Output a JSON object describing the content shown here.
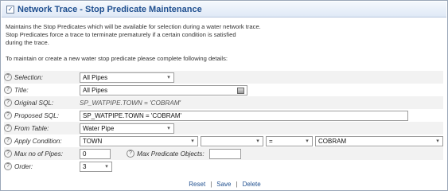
{
  "window": {
    "title": "Network Trace - Stop Predicate Maintenance"
  },
  "description": {
    "line1": "Maintains the Stop Predicates which will be available for selection during a water network trace.",
    "line2": "Stop Predicates force a trace to terminate prematurely if a certain condition is satisfied",
    "line3": "during the trace.",
    "line4": "To maintain or create a new water stop predicate please complete following details:"
  },
  "form": {
    "selection": {
      "label": "Selection:",
      "value": "All Pipes"
    },
    "title": {
      "label": "Title:",
      "value": "All Pipes"
    },
    "original_sql": {
      "label": "Original SQL:",
      "value": "SP_WATPIPE.TOWN = 'COBRAM'"
    },
    "proposed_sql": {
      "label": "Proposed SQL:",
      "value": "SP_WATPIPE.TOWN = 'COBRAM'"
    },
    "from_table": {
      "label": "From Table:",
      "value": "Water Pipe"
    },
    "apply_condition": {
      "label": "Apply Condition:",
      "field": "TOWN",
      "second": "",
      "operator": "=",
      "value": "COBRAM"
    },
    "max_pipes": {
      "label": "Max no of Pipes:",
      "value": "0"
    },
    "max_objects": {
      "label": "Max Predicate Objects:",
      "value": ""
    },
    "order": {
      "label": "Order:",
      "value": "3"
    }
  },
  "footer": {
    "reset": "Reset",
    "save": "Save",
    "delete": "Delete",
    "separator": "|"
  },
  "icons": {
    "help": "question-icon",
    "lookup": "lookup-icon",
    "dropdown": "chevron-down-icon"
  }
}
